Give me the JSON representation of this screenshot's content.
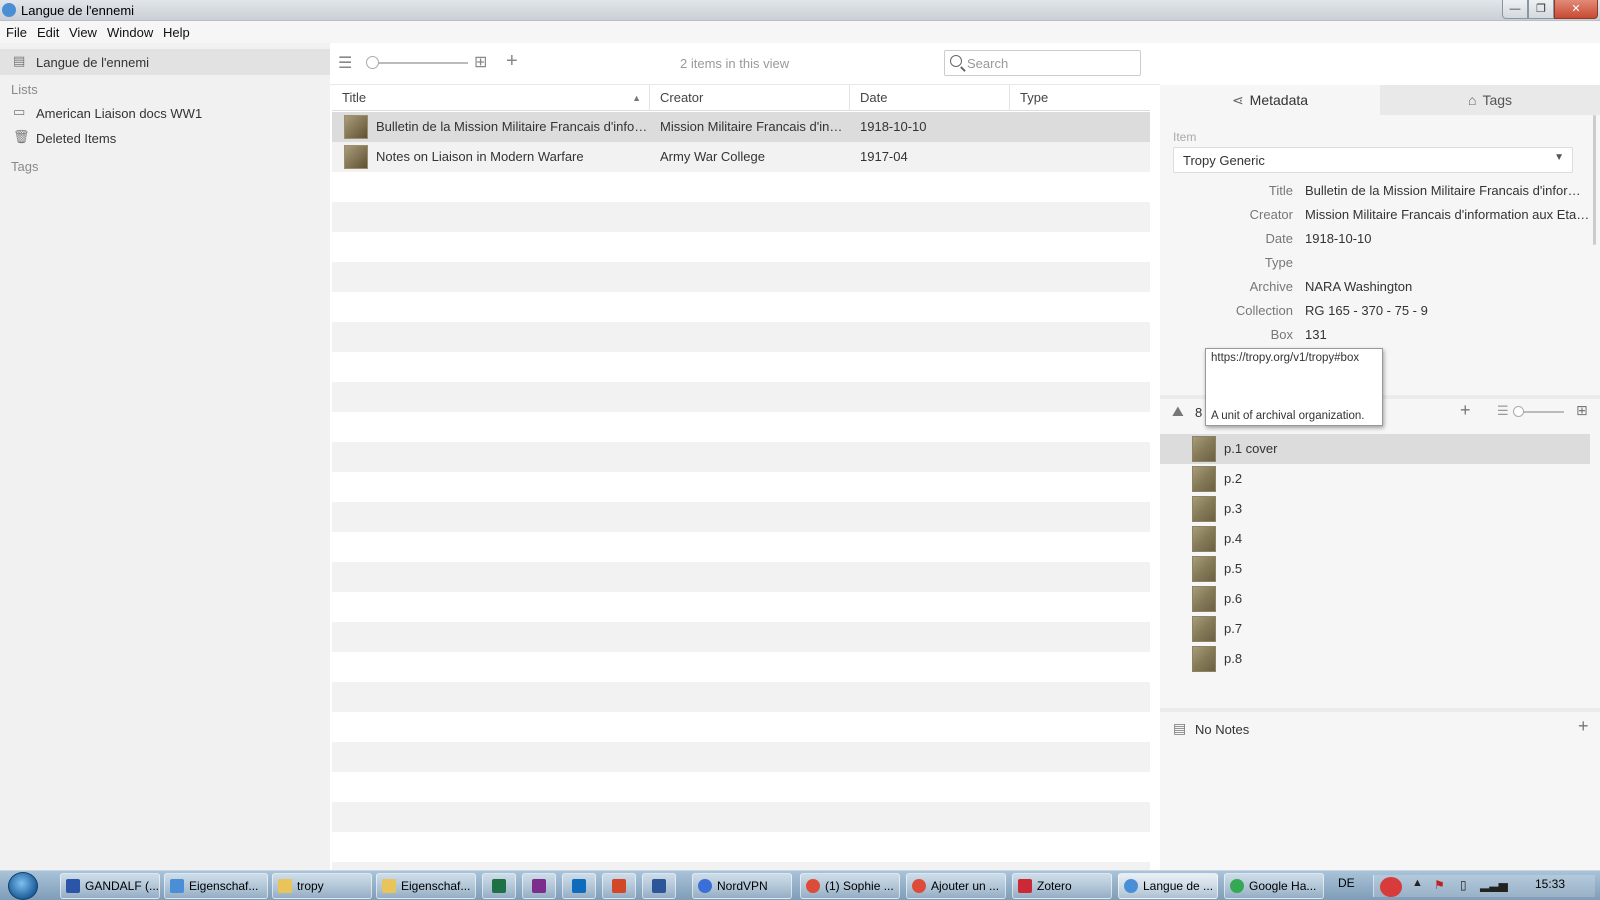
{
  "window": {
    "title": "Langue de l'ennemi",
    "min": "—",
    "max": "❐",
    "close": "✕"
  },
  "menu": [
    "File",
    "Edit",
    "View",
    "Window",
    "Help"
  ],
  "sidebar": {
    "project": "Langue de l'ennemi",
    "lists_heading": "Lists",
    "lists": [
      "American Liaison docs WW1"
    ],
    "trash": "Deleted Items",
    "tags_heading": "Tags"
  },
  "toolbar": {
    "item_count": "2 items in this view",
    "search_placeholder": "Search"
  },
  "table": {
    "columns": [
      "Title",
      "Creator",
      "Date",
      "Type"
    ],
    "rows": [
      {
        "title": "Bulletin de la Mission Militaire Francais d'information aux Etats-Unis",
        "creator": "Mission Militaire Francais d'information aux Etats-Unis",
        "date": "1918-10-10",
        "type": ""
      },
      {
        "title": "Notes on Liaison in Modern Warfare",
        "creator": "Army War College",
        "date": "1917-04",
        "type": ""
      }
    ]
  },
  "panel": {
    "tabs": [
      "Metadata",
      "Tags"
    ],
    "item_label": "Item",
    "template": "Tropy Generic",
    "fields": [
      {
        "label": "Title",
        "value": "Bulletin de la Mission Militaire Francais d'information aux Etats-Unis"
      },
      {
        "label": "Creator",
        "value": "Mission Militaire Francais d'information aux Etats-Unis"
      },
      {
        "label": "Date",
        "value": "1918-10-10"
      },
      {
        "label": "Type",
        "value": ""
      },
      {
        "label": "Archive",
        "value": "NARA Washington"
      },
      {
        "label": "Collection",
        "value": "RG 165 - 370 - 75 - 9"
      },
      {
        "label": "Box",
        "value": "131"
      }
    ],
    "tooltip": {
      "uri": "https://tropy.org/v1/tropy#box",
      "description": "A unit of archival organization."
    },
    "photo_count": "8",
    "photos": [
      "p.1 cover",
      "p.2",
      "p.3",
      "p.4",
      "p.5",
      "p.6",
      "p.7",
      "p.8"
    ],
    "notes": "No Notes"
  },
  "taskbar": {
    "tasks": [
      "GANDALF (...",
      "Eigenschaf...",
      "tropy",
      "Eigenschaf...",
      "",
      "",
      "",
      "",
      "",
      "NordVPN",
      "(1) Sophie ...",
      "Ajouter un ...",
      "Zotero",
      "Langue de ...",
      "Google Ha..."
    ],
    "lang": "DE",
    "time": "15:33"
  },
  "colors": {
    "selected_row": "#dcdcdc",
    "sidebar_bg": "#f1f1f1",
    "panel_bg": "#f6f6f6",
    "taskbar": "#8fb0cc"
  }
}
